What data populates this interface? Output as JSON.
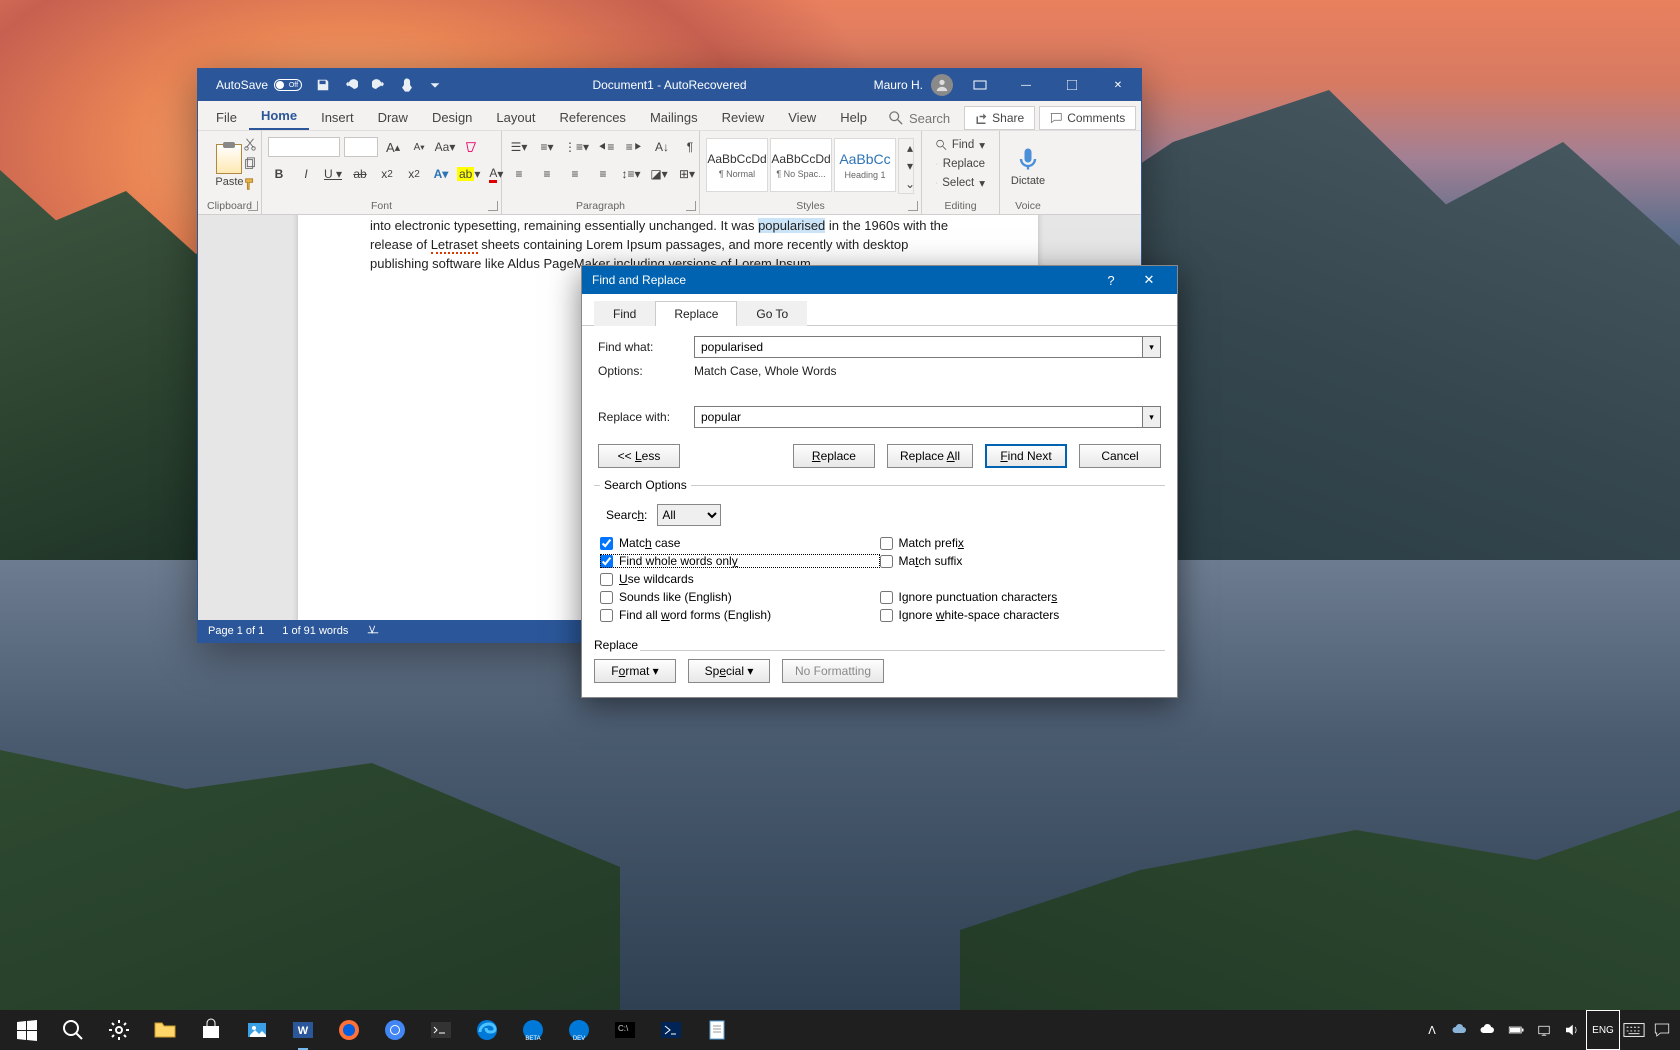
{
  "word": {
    "titlebar": {
      "autosave_label": "AutoSave",
      "autosave_state": "Off",
      "doc_title": "Document1  -  AutoRecovered",
      "user_name": "Mauro H."
    },
    "menu": {
      "file": "File",
      "home": "Home",
      "insert": "Insert",
      "draw": "Draw",
      "design": "Design",
      "layout": "Layout",
      "references": "References",
      "mailings": "Mailings",
      "review": "Review",
      "view": "View",
      "help": "Help",
      "search_placeholder": "Search",
      "share": "Share",
      "comments": "Comments"
    },
    "ribbon": {
      "clipboard": {
        "label": "Clipboard",
        "paste": "Paste"
      },
      "font": {
        "label": "Font"
      },
      "paragraph": {
        "label": "Paragraph"
      },
      "styles": {
        "label": "Styles",
        "items": [
          {
            "preview": "AaBbCcDd",
            "name": "¶ Normal"
          },
          {
            "preview": "AaBbCcDd",
            "name": "¶ No Spac..."
          },
          {
            "preview": "AaBbCc",
            "name": "Heading 1"
          }
        ]
      },
      "editing": {
        "label": "Editing",
        "find": "Find",
        "replace": "Replace",
        "select": "Select"
      },
      "voice": {
        "label": "Voice",
        "dictate": "Dictate"
      }
    },
    "document": {
      "line1_a": "into electronic typesetting, remaining essentially unchanged. It was ",
      "line1_sel": "popularised",
      "line1_b": " in the 1960s with the",
      "line2_a": "release of ",
      "line2_err": "Letraset",
      "line2_b": " sheets containing Lorem Ipsum passages, and more recently with desktop publishing",
      "line3": "software like Aldus PageMaker including versions of Lorem Ipsum."
    },
    "statusbar": {
      "page": "Page 1 of 1",
      "words": "1 of 91 words"
    }
  },
  "dialog": {
    "title": "Find and Replace",
    "tabs": {
      "find": "Find",
      "replace": "Replace",
      "goto": "Go To"
    },
    "find_label": "Find what:",
    "find_value": "popularised",
    "options_label": "Options:",
    "options_value": "Match Case, Whole Words",
    "replace_label": "Replace with:",
    "replace_value": "popular",
    "btn_less": "<< Less",
    "btn_replace": "Replace",
    "btn_replace_all": "Replace All",
    "btn_find_next": "Find Next",
    "btn_cancel": "Cancel",
    "search_options_legend": "Search Options",
    "search_dir_label": "Search:",
    "search_dir_value": "All",
    "chk_match_case": "Match case",
    "chk_whole_words": "Find whole words only",
    "chk_wildcards": "Use wildcards",
    "chk_sounds_like": "Sounds like (English)",
    "chk_word_forms": "Find all word forms (English)",
    "chk_prefix": "Match prefix",
    "chk_suffix": "Match suffix",
    "chk_punct": "Ignore punctuation characters",
    "chk_white": "Ignore white-space characters",
    "replace_section": "Replace",
    "btn_format": "Format",
    "btn_special": "Special",
    "btn_noformat": "No Formatting"
  },
  "taskbar": {
    "time": "",
    "date": ""
  }
}
